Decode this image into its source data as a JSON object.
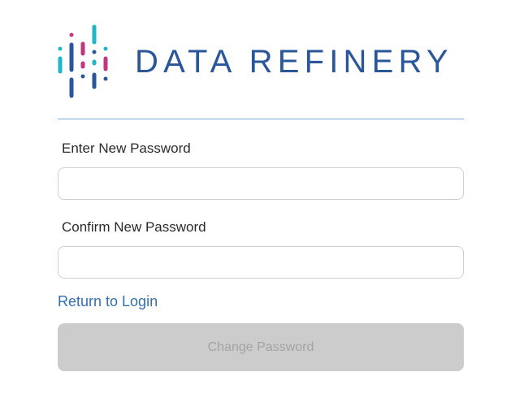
{
  "brand": {
    "name": "DATA REFINERY",
    "logo_icon": "data-refinery-logo-icon",
    "colors": {
      "blue": "#2a579a",
      "teal": "#1fb7c8",
      "magenta": "#c0377c"
    }
  },
  "form": {
    "new_password_label": "Enter New Password",
    "new_password_value": "",
    "confirm_password_label": "Confirm New Password",
    "confirm_password_value": "",
    "return_link_label": "Return to Login",
    "submit_label": "Change Password",
    "submit_state": "disabled"
  },
  "colors": {
    "divider": "#7fa9d6",
    "link": "#3370b0",
    "button_bg_disabled": "#cccccc",
    "button_text_disabled": "#a3a3a3"
  }
}
